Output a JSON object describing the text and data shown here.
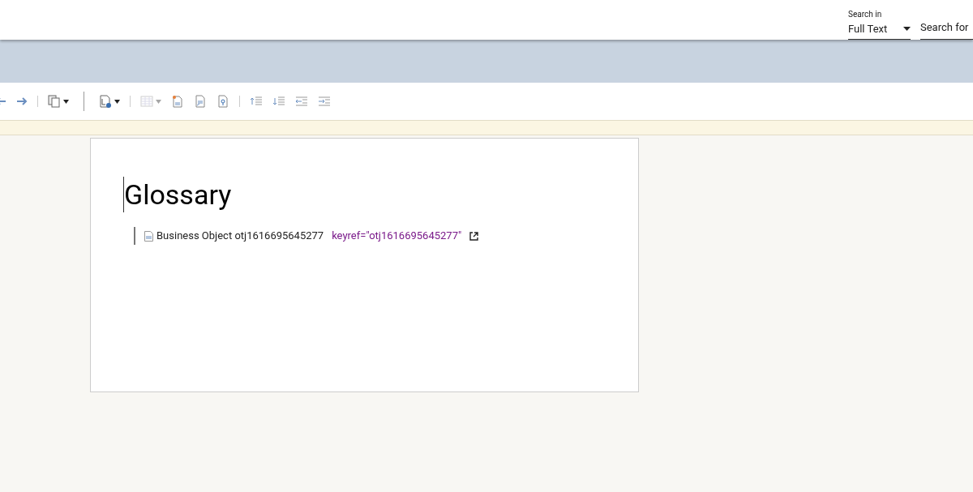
{
  "search": {
    "scope_label": "Search in",
    "scope_value": "Full Text",
    "placeholder": "Search for"
  },
  "toolbar": [
    {
      "kind": "back",
      "disabled": false
    },
    {
      "kind": "forward",
      "disabled": false
    },
    {
      "kind": "sep"
    },
    {
      "kind": "copy",
      "disabled": false,
      "dropdown": true
    },
    {
      "kind": "bigsep"
    },
    {
      "kind": "map",
      "disabled": false,
      "dropdown": true
    },
    {
      "kind": "sep"
    },
    {
      "kind": "table",
      "disabled": true,
      "dropdown": true
    },
    {
      "kind": "newdoc",
      "disabled": false
    },
    {
      "kind": "doc",
      "disabled": false
    },
    {
      "kind": "keydoc",
      "disabled": false
    },
    {
      "kind": "sep"
    },
    {
      "kind": "moveup",
      "disabled": false
    },
    {
      "kind": "movedown",
      "disabled": false
    },
    {
      "kind": "outdent",
      "disabled": false
    },
    {
      "kind": "indent",
      "disabled": false
    }
  ],
  "document": {
    "title": "Glossary",
    "entries": [
      {
        "label": "Business Object otj1616695645277",
        "keyref": "keyref=\"otj1616695645277\""
      }
    ]
  }
}
